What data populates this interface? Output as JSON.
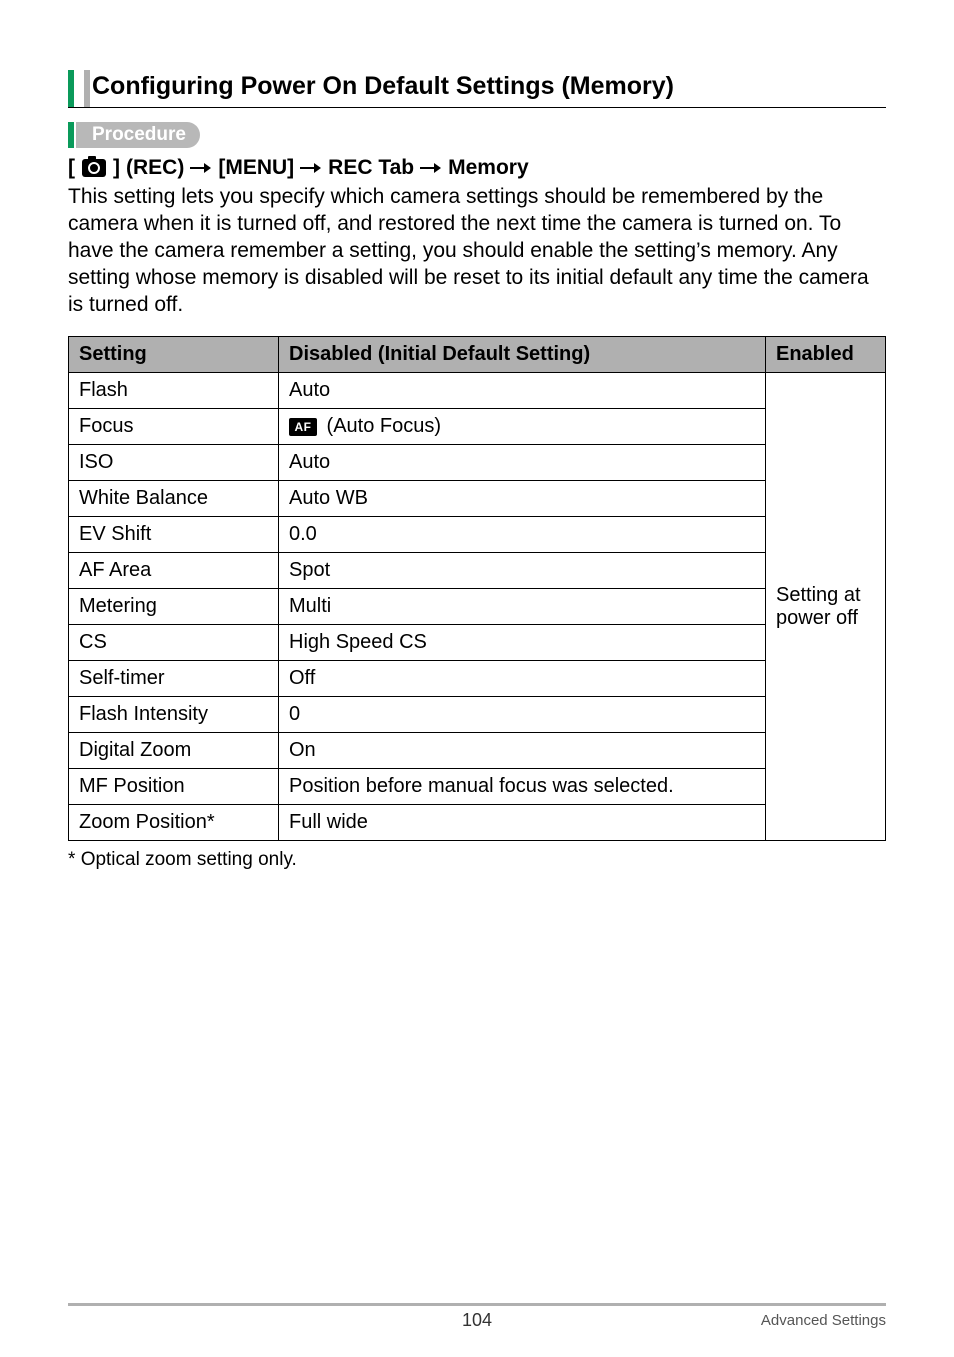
{
  "heading": "Configuring Power On Default Settings (Memory)",
  "procedure_label": "Procedure",
  "breadcrumb": {
    "rec_label": "(REC)",
    "menu_label": "[MENU]",
    "tab_label": "REC Tab",
    "dest_label": "Memory"
  },
  "body": "This setting lets you specify which camera settings should be remembered by the camera when it is turned off, and restored the next time the camera is turned on. To have the camera remember a setting, you should enable the setting’s memory. Any setting whose memory is disabled will be reset to its initial default any time the camera is turned off.",
  "table": {
    "headers": {
      "setting": "Setting",
      "disabled": "Disabled (Initial Default Setting)",
      "enabled": "Enabled"
    },
    "rows": [
      {
        "setting": "Flash",
        "disabled": "Auto",
        "af_icon": false
      },
      {
        "setting": "Focus",
        "disabled": "(Auto Focus)",
        "af_icon": true
      },
      {
        "setting": "ISO",
        "disabled": "Auto",
        "af_icon": false
      },
      {
        "setting": "White Balance",
        "disabled": "Auto WB",
        "af_icon": false
      },
      {
        "setting": "EV Shift",
        "disabled": "0.0",
        "af_icon": false
      },
      {
        "setting": "AF Area",
        "disabled": "Spot",
        "af_icon": false
      },
      {
        "setting": "Metering",
        "disabled": "Multi",
        "af_icon": false
      },
      {
        "setting": "CS",
        "disabled": "High Speed CS",
        "af_icon": false
      },
      {
        "setting": "Self-timer",
        "disabled": "Off",
        "af_icon": false
      },
      {
        "setting": "Flash Intensity",
        "disabled": "0",
        "af_icon": false
      },
      {
        "setting": "Digital Zoom",
        "disabled": "On",
        "af_icon": false
      },
      {
        "setting": "MF Position",
        "disabled": "Position before manual focus was selected.",
        "af_icon": false
      },
      {
        "setting": "Zoom Position*",
        "disabled": "Full wide",
        "af_icon": false
      }
    ],
    "enabled_text": "Setting at power off"
  },
  "footnote_marker": "*",
  "footnote_text": "Optical zoom setting only.",
  "af_label": "AF",
  "footer": {
    "page": "104",
    "section": "Advanced Settings"
  }
}
